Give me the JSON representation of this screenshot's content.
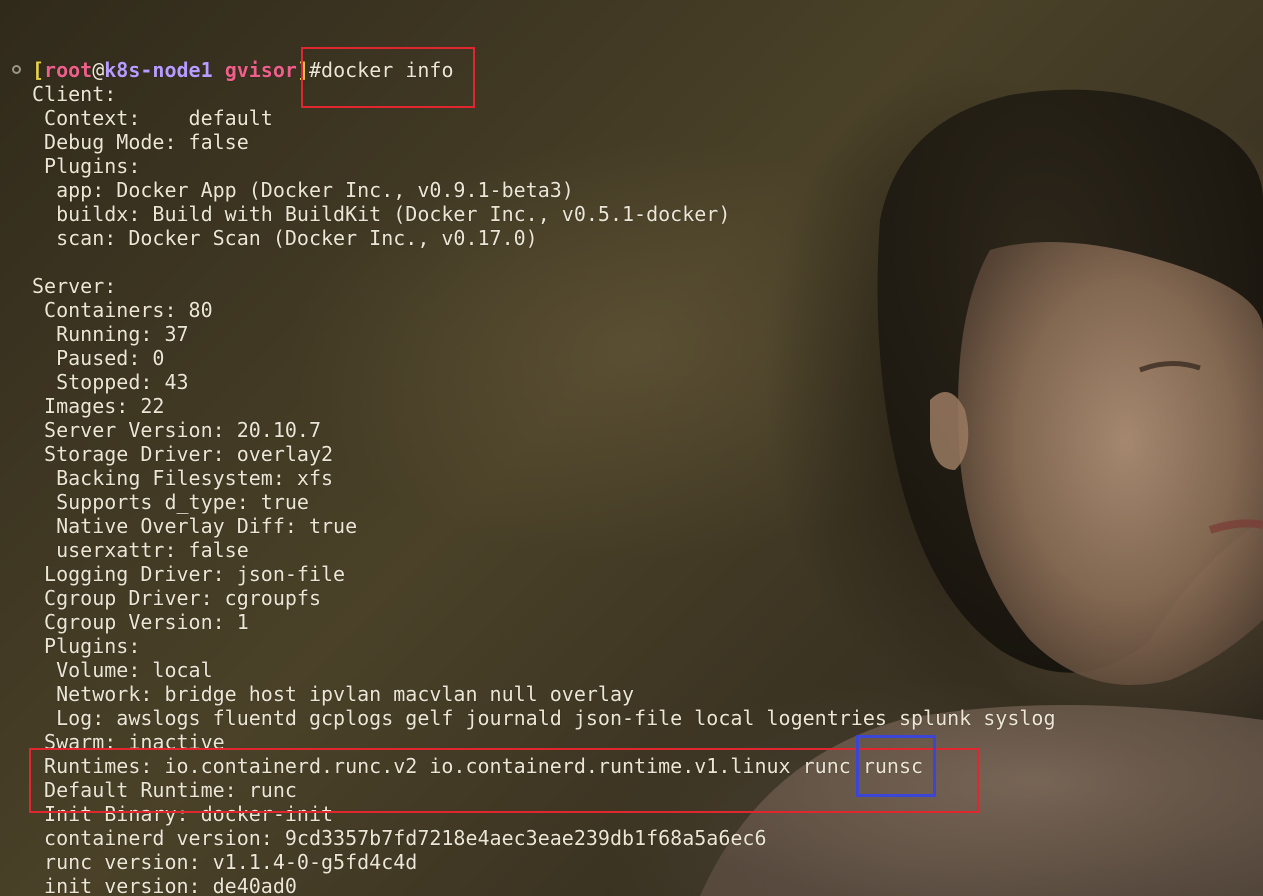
{
  "prompt": {
    "open_bracket": "[",
    "user": "root",
    "at": "@",
    "host": "k8s-node1",
    "space": " ",
    "dir": "gvisor",
    "close_bracket": "]",
    "symbol": "#",
    "command": "docker info"
  },
  "output_lines": [
    "Client:",
    " Context:    default",
    " Debug Mode: false",
    " Plugins:",
    "  app: Docker App (Docker Inc., v0.9.1-beta3)",
    "  buildx: Build with BuildKit (Docker Inc., v0.5.1-docker)",
    "  scan: Docker Scan (Docker Inc., v0.17.0)",
    "",
    "Server:",
    " Containers: 80",
    "  Running: 37",
    "  Paused: 0",
    "  Stopped: 43",
    " Images: 22",
    " Server Version: 20.10.7",
    " Storage Driver: overlay2",
    "  Backing Filesystem: xfs",
    "  Supports d_type: true",
    "  Native Overlay Diff: true",
    "  userxattr: false",
    " Logging Driver: json-file",
    " Cgroup Driver: cgroupfs",
    " Cgroup Version: 1",
    " Plugins:",
    "  Volume: local",
    "  Network: bridge host ipvlan macvlan null overlay",
    "  Log: awslogs fluentd gcplogs gelf journald json-file local logentries splunk syslog",
    " Swarm: inactive",
    " Runtimes: io.containerd.runc.v2 io.containerd.runtime.v1.linux runc runsc",
    " Default Runtime: runc",
    " Init Binary: docker-init",
    " containerd version: 9cd3357b7fd7218e4aec3eae239db1f68a5a6ec6",
    " runc version: v1.1.4-0-g5fd4c4d",
    " init version: de40ad0"
  ],
  "colors": {
    "bracket": "#e8d24a",
    "user": "#ef5f8c",
    "host": "#b89cff",
    "dir": "#ef5f8c",
    "text": "#ece6d6",
    "highlight_red": "#e0262e",
    "highlight_blue": "#3b46d6"
  },
  "icons": {
    "status_dot": "circle-outline-icon"
  },
  "background": "photo-wallpaper"
}
